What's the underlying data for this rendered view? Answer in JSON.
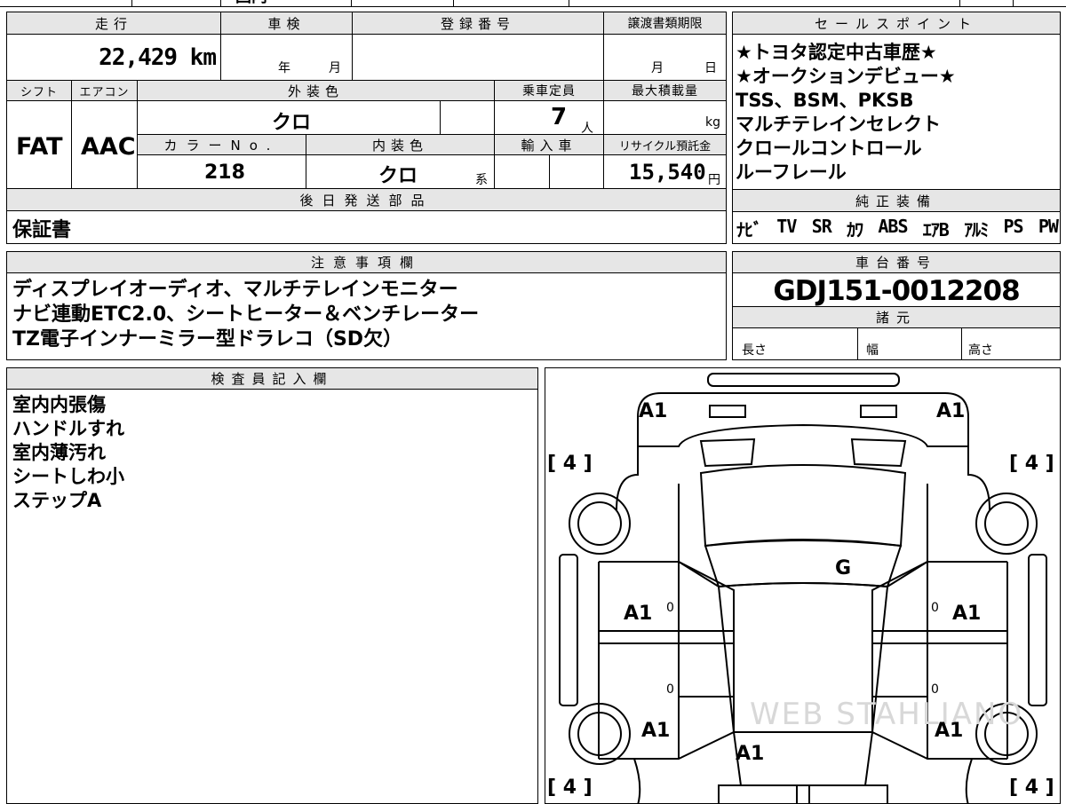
{
  "top_strip": {
    "text": "国内"
  },
  "header": {
    "mileage_label": "走行",
    "inspection_label": "車検",
    "reg_no_label": "登録番号",
    "transfer_deadline_label": "譲渡書類期限",
    "mileage": "22,429 km",
    "year_unit": "年",
    "month_unit": "月",
    "deadline_month": "月",
    "deadline_day": "日"
  },
  "specs": {
    "shift_label": "シフト",
    "ac_label": "エアコン",
    "ext_color_label": "外装色",
    "capacity_label": "乗車定員",
    "max_load_label": "最大積載量",
    "shift": "FAT",
    "ac": "AAC",
    "ext_color": "クロ",
    "capacity": "7",
    "capacity_unit": "人",
    "load_unit": "kg",
    "color_no_label": "カラーNo.",
    "int_color_label": "内装色",
    "import_label": "輸入車",
    "recycle_label": "リサイクル預託金",
    "color_no": "218",
    "int_color": "クロ",
    "int_color_suffix": "系",
    "recycle_fee": "15,540",
    "recycle_unit": "円"
  },
  "later_parts": {
    "label": "後日発送部品",
    "value": "保証書"
  },
  "sales_points": {
    "label": "セールスポイント",
    "lines": [
      "★トヨタ認定中古車歴★",
      "★オークションデビュー★",
      "TSS、BSM、PKSB",
      "マルチテレインセレクト",
      "クロールコントロール",
      "ルーフレール"
    ]
  },
  "equipment": {
    "label": "純正装備",
    "items": [
      "ﾅﾋﾞ",
      "TV",
      "SR",
      "ｶﾜ",
      "ABS",
      "ｴｱB",
      "ｱﾙﾐ",
      "PS",
      "PW"
    ]
  },
  "notes": {
    "label": "注意事項欄",
    "lines": [
      "ディスプレイオーディオ、マルチテレインモニター",
      "ナビ連動ETC2.0、シートヒーター＆ベンチレーター",
      "TZ電子インナーミラー型ドラレコ（SD欠）"
    ]
  },
  "chassis": {
    "label": "車台番号",
    "value": "GDJ151-0012208"
  },
  "dimensions": {
    "label": "諸元",
    "length_label": "長さ",
    "width_label": "幅",
    "height_label": "高さ"
  },
  "inspector": {
    "label": "検査員記入欄",
    "lines": [
      "室内内張傷",
      "ハンドルすれ",
      "室内薄汚れ",
      "シートしわ小",
      "ステップA"
    ]
  },
  "diagram": {
    "front_left": "A1",
    "front_right": "A1",
    "tire_fl": "[ 4 ]",
    "tire_fr": "[ 4 ]",
    "tire_rl": "[ 4 ]",
    "tire_rr": "[ 4 ]",
    "roof": "G",
    "door_fl": "A1",
    "door_fr": "A1",
    "zero_1": "0",
    "zero_2": "0",
    "zero_3": "0",
    "zero_4": "0",
    "rear_left": "A1",
    "rear_right": "A1",
    "tailgate": "A1",
    "watermark": "WEB STAHLIANO"
  }
}
